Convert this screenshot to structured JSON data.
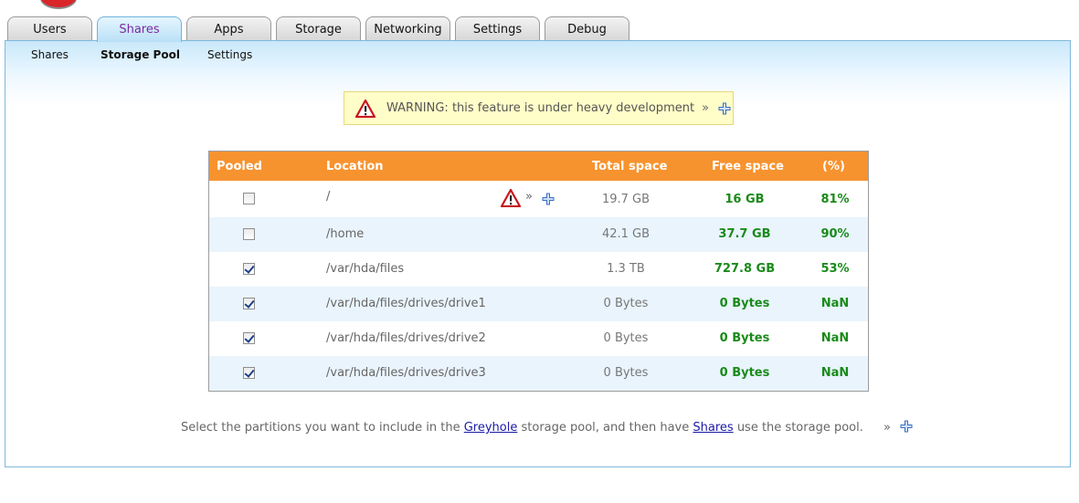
{
  "tabs": [
    {
      "label": "Users"
    },
    {
      "label": "Shares"
    },
    {
      "label": "Apps"
    },
    {
      "label": "Storage"
    },
    {
      "label": "Networking"
    },
    {
      "label": "Settings"
    },
    {
      "label": "Debug"
    }
  ],
  "active_tab": "Shares",
  "subnav": [
    {
      "label": "Shares"
    },
    {
      "label": "Storage Pool"
    },
    {
      "label": "Settings"
    }
  ],
  "active_subnav": "Storage Pool",
  "warning": {
    "text": "WARNING: this feature is under heavy development",
    "more": "»"
  },
  "table": {
    "headers": {
      "pooled": "Pooled",
      "location": "Location",
      "total": "Total space",
      "free": "Free space",
      "pct": "(%)"
    },
    "rows": [
      {
        "pooled": false,
        "location": "/",
        "total": "19.7 GB",
        "free": "16 GB",
        "pct": "81%",
        "has_warning": true,
        "more": "»"
      },
      {
        "pooled": false,
        "location": "/home",
        "total": "42.1 GB",
        "free": "37.7 GB",
        "pct": "90%"
      },
      {
        "pooled": true,
        "location": "/var/hda/files",
        "total": "1.3 TB",
        "free": "727.8 GB",
        "pct": "53%"
      },
      {
        "pooled": true,
        "location": "/var/hda/files/drives/drive1",
        "total": "0 Bytes",
        "free": "0 Bytes",
        "pct": "NaN"
      },
      {
        "pooled": true,
        "location": "/var/hda/files/drives/drive2",
        "total": "0 Bytes",
        "free": "0 Bytes",
        "pct": "NaN"
      },
      {
        "pooled": true,
        "location": "/var/hda/files/drives/drive3",
        "total": "0 Bytes",
        "free": "0 Bytes",
        "pct": "NaN"
      }
    ]
  },
  "footer": {
    "text_before": "Select the partitions you want to include in the ",
    "link1": "Greyhole",
    "text_middle": " storage pool, and then have ",
    "link2": "Shares",
    "text_after": " use the storage pool.",
    "more": "»"
  },
  "colors": {
    "header_orange": "#f7932f",
    "value_green": "#1a8a1a",
    "active_tab_text": "#7a2aa0",
    "row_alt": "#e9f4fd"
  }
}
